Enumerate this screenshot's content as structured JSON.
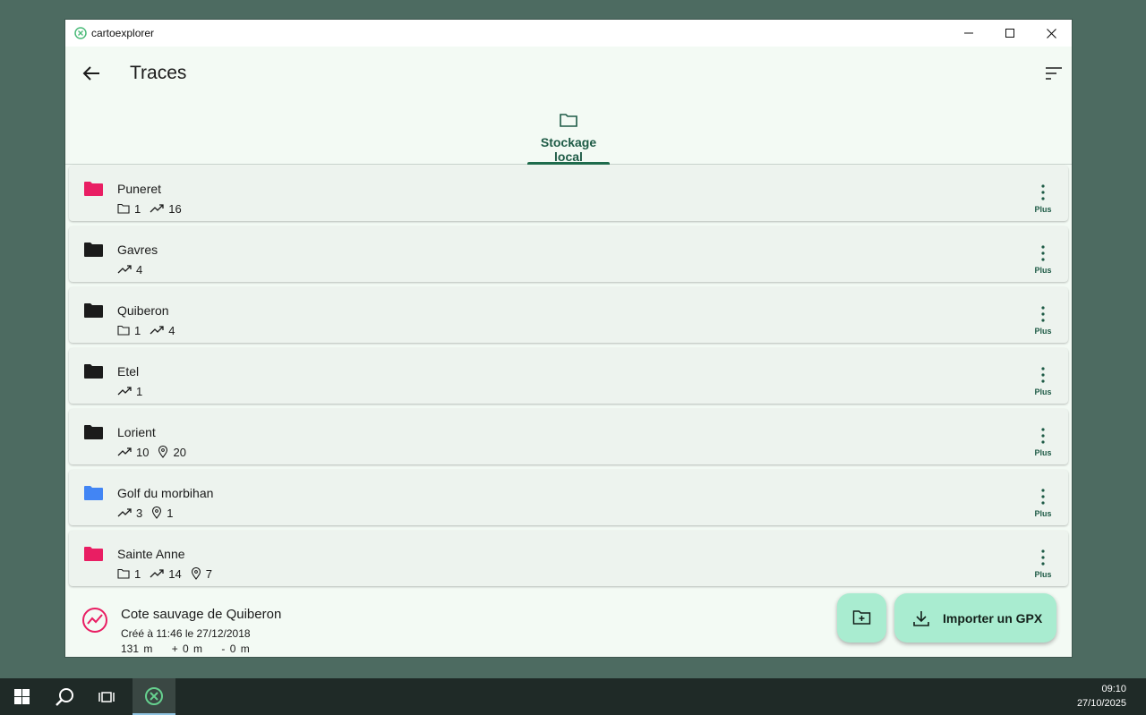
{
  "window": {
    "app_title": "cartoexplorer"
  },
  "appbar": {
    "title": "Traces"
  },
  "tabs": [
    {
      "label": "Stockage local"
    }
  ],
  "colors": {
    "accent": "#1e6b4c",
    "fab": "#a9ecd0",
    "folder_pink": "#e91e63",
    "folder_blue": "#4285f4",
    "folder_black": "#1b1b1b"
  },
  "folders": [
    {
      "name": "Puneret",
      "color": "#e91e63",
      "stats": [
        {
          "icon": "folder-outline-icon",
          "value": "1"
        },
        {
          "icon": "track-line-icon",
          "value": "16"
        }
      ],
      "more_label": "Plus"
    },
    {
      "name": "Gavres",
      "color": "#1b1b1b",
      "stats": [
        {
          "icon": "track-line-icon",
          "value": "4"
        }
      ],
      "more_label": "Plus"
    },
    {
      "name": "Quiberon",
      "color": "#1b1b1b",
      "stats": [
        {
          "icon": "folder-outline-icon",
          "value": "1"
        },
        {
          "icon": "track-line-icon",
          "value": "4"
        }
      ],
      "more_label": "Plus"
    },
    {
      "name": "Etel",
      "color": "#1b1b1b",
      "stats": [
        {
          "icon": "track-line-icon",
          "value": "1"
        }
      ],
      "more_label": "Plus"
    },
    {
      "name": "Lorient",
      "color": "#1b1b1b",
      "stats": [
        {
          "icon": "track-line-icon",
          "value": "10"
        },
        {
          "icon": "map-pin-icon",
          "value": "20"
        }
      ],
      "more_label": "Plus"
    },
    {
      "name": "Golf du morbihan",
      "color": "#4285f4",
      "stats": [
        {
          "icon": "track-line-icon",
          "value": "3"
        },
        {
          "icon": "map-pin-icon",
          "value": "1"
        }
      ],
      "more_label": "Plus"
    },
    {
      "name": "Sainte Anne",
      "color": "#e91e63",
      "stats": [
        {
          "icon": "folder-outline-icon",
          "value": "1"
        },
        {
          "icon": "track-line-icon",
          "value": "14"
        },
        {
          "icon": "map-pin-icon",
          "value": "7"
        }
      ],
      "more_label": "Plus"
    }
  ],
  "track": {
    "name": "Cote sauvage de Quiberon",
    "created": "Créé à 11:46 le 27/12/2018",
    "stats": "131 m    + 0 m    - 0 m"
  },
  "fab": {
    "import_label": "Importer un GPX"
  },
  "taskbar": {
    "time": "09:10",
    "date": "27/10/2025"
  }
}
